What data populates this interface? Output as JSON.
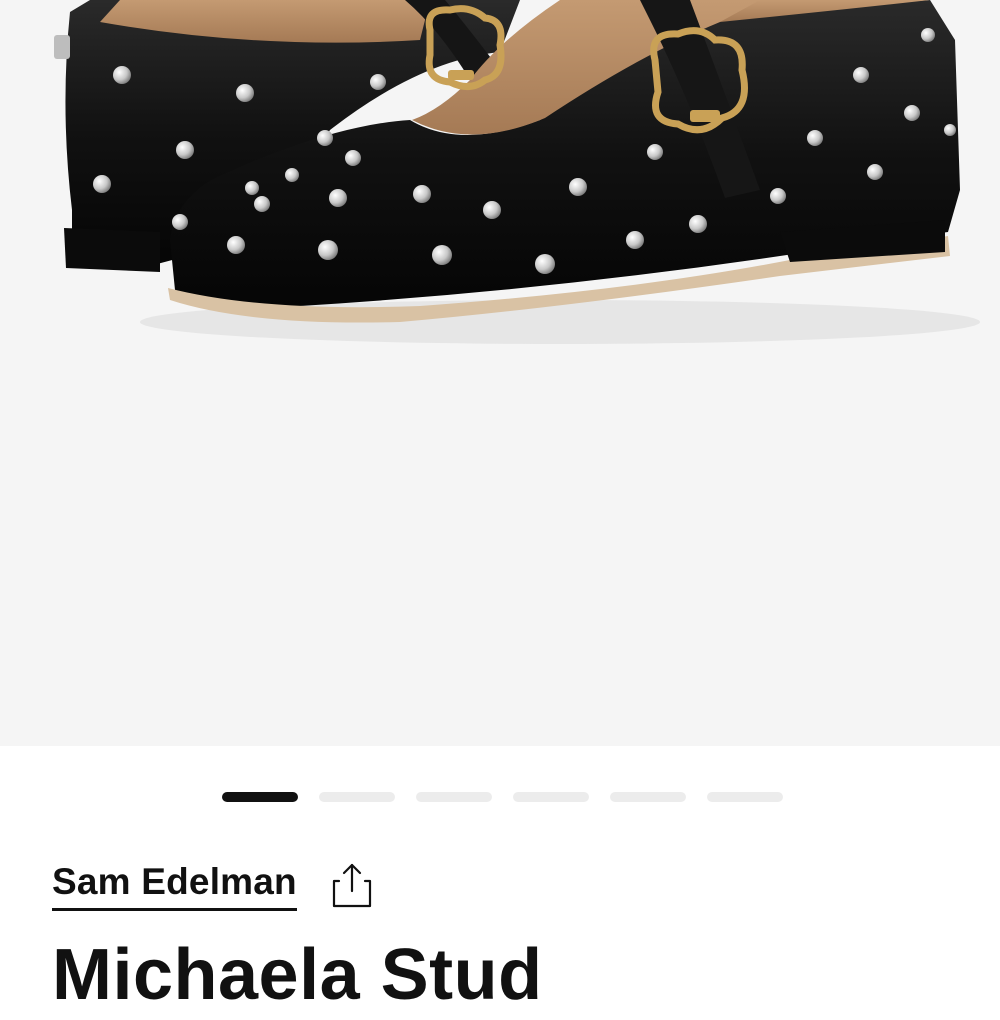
{
  "product": {
    "brand": "Sam Edelman",
    "name": "Michaela Stud"
  },
  "gallery": {
    "image_count": 6,
    "active_index": 0,
    "image_alt_subject": "black leather studded mary jane flats with gold buckle"
  },
  "icons": {
    "share": "share-icon"
  },
  "colors": {
    "gallery_bg": "#f5f5f5",
    "indicator_active": "#111111",
    "indicator_inactive": "#ececec",
    "text": "#111111"
  }
}
